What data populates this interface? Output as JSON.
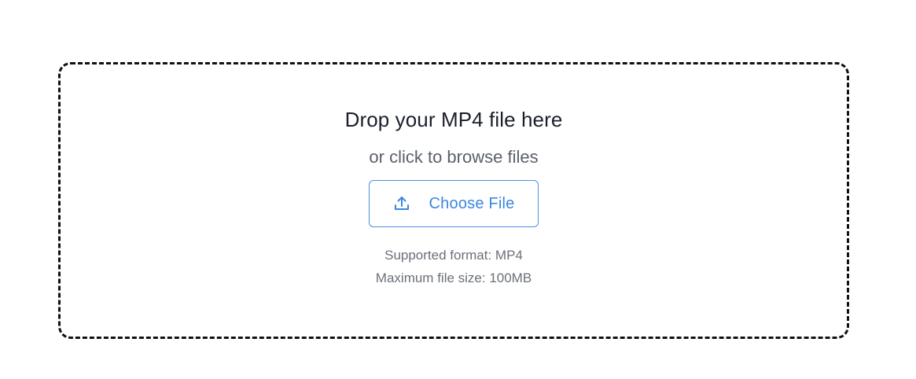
{
  "dropzone": {
    "title": "Drop your MP4 file here",
    "subtitle": "or click to browse files",
    "button": {
      "label": "Choose File",
      "icon": "upload-icon"
    },
    "supported_format": "Supported format: MP4",
    "max_size": "Maximum file size: 100MB"
  },
  "colors": {
    "accent": "#3b87e0",
    "border": "#111111",
    "title_text": "#1a1f2b",
    "muted_text": "#6b7079"
  }
}
